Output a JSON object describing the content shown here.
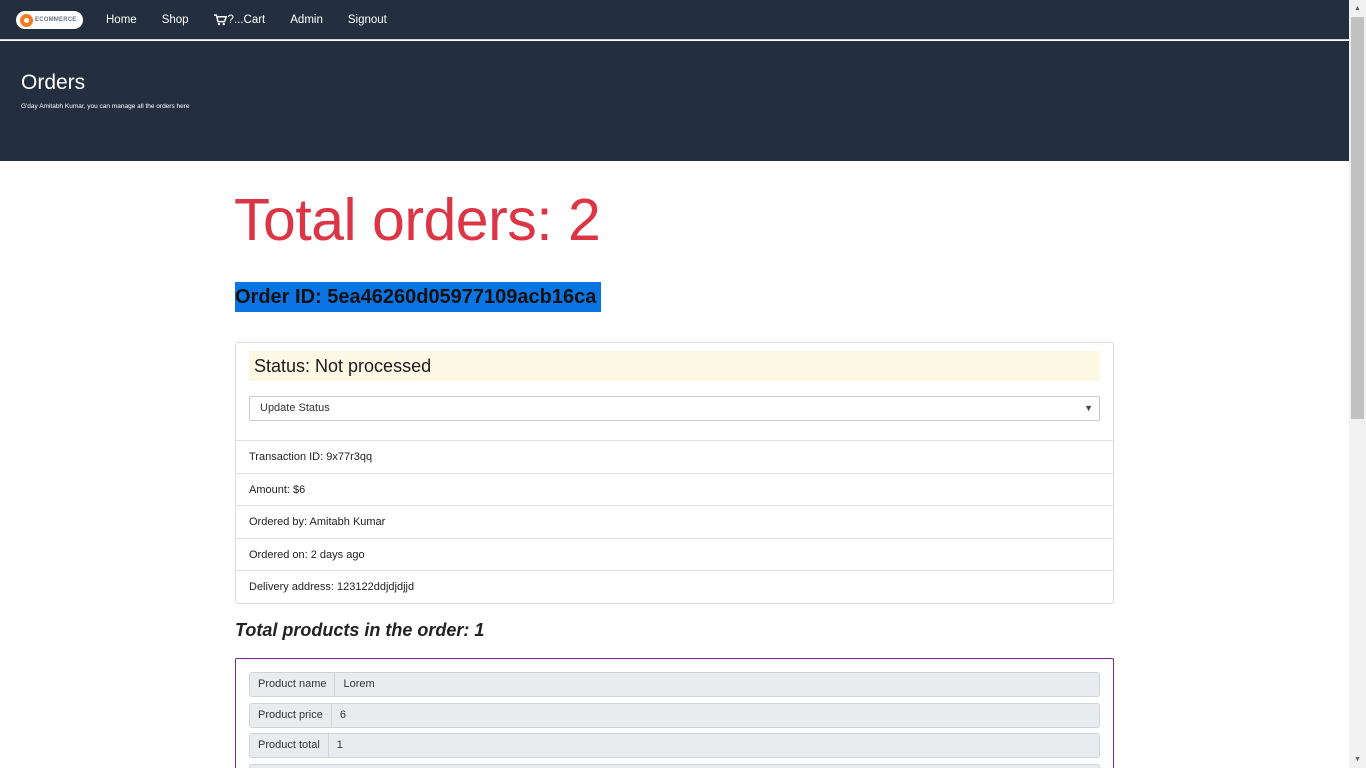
{
  "navbar": {
    "logo_text": "ECOMMERCE",
    "links": [
      "Home",
      "Shop",
      "?...Cart",
      "Admin",
      "Signout"
    ]
  },
  "header": {
    "title": "Orders",
    "subtitle": "G'day Amitabh Kumar, you can manage all the orders here"
  },
  "main": {
    "total_orders": "Total orders: 2",
    "order_id": "Order ID: 5ea46260d05977109acb16ca",
    "status": "Status: Not processed",
    "status_select": "Update Status",
    "info": [
      "Transaction ID: 9x77r3qq",
      "Amount: $6",
      "Ordered by: Amitabh Kumar",
      "Ordered on: 2 days ago",
      "Delivery address: 123122ddjdjdjjd"
    ],
    "products_heading": "Total products in the order: 1",
    "product_fields": [
      {
        "label": "Product name",
        "value": "Lorem"
      },
      {
        "label": "Product price",
        "value": "6"
      },
      {
        "label": "Product total",
        "value": "1"
      }
    ]
  },
  "colors": {
    "navbar_bg": "#232f3f",
    "accent_red": "#dc3545",
    "selection_blue": "#0a74e3",
    "status_bg": "#fdf8e4",
    "product_border": "#6f2b8a"
  },
  "icons": {
    "cart": "cart-icon",
    "logo": "ecommerce-logo-icon"
  }
}
